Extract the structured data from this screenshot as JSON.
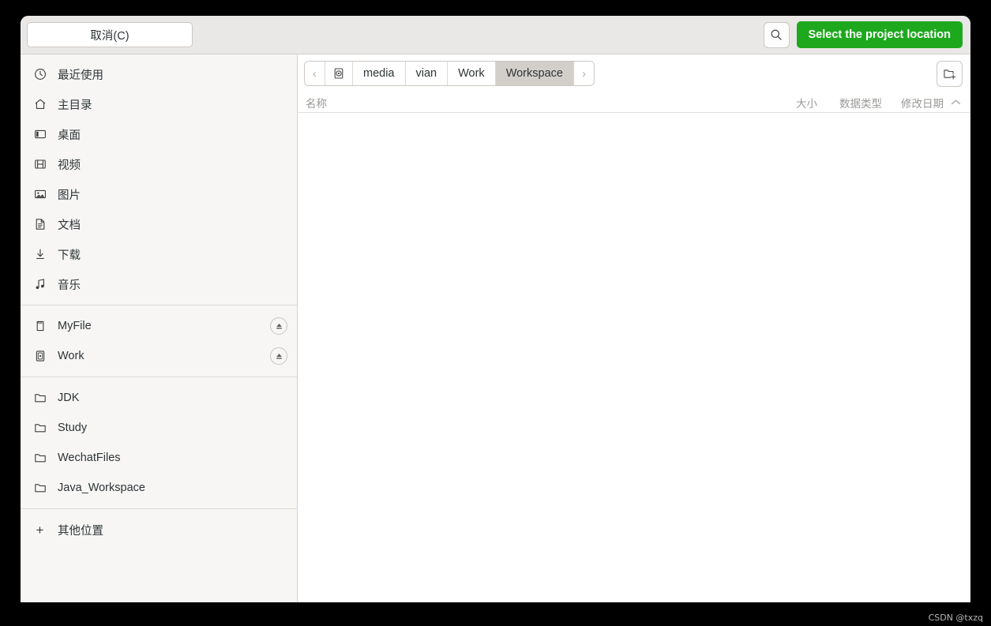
{
  "header": {
    "cancel_label": "取消(C)",
    "search_icon": "search-icon",
    "select_label": "Select the project location",
    "accent_color": "#1da81d"
  },
  "sidebar": {
    "places": [
      {
        "label": "最近使用",
        "icon": "clock-icon"
      },
      {
        "label": "主目录",
        "icon": "home-icon"
      },
      {
        "label": "桌面",
        "icon": "desktop-icon"
      },
      {
        "label": "视频",
        "icon": "film-icon"
      },
      {
        "label": "图片",
        "icon": "image-icon"
      },
      {
        "label": "文档",
        "icon": "document-icon"
      },
      {
        "label": "下载",
        "icon": "download-icon"
      },
      {
        "label": "音乐",
        "icon": "music-icon"
      }
    ],
    "devices": [
      {
        "label": "MyFile",
        "icon": "sd-card-icon",
        "eject": "eject-icon"
      },
      {
        "label": "Work",
        "icon": "drive-icon",
        "eject": "eject-icon"
      }
    ],
    "bookmarks": [
      {
        "label": "JDK",
        "icon": "folder-icon"
      },
      {
        "label": "Study",
        "icon": "folder-icon"
      },
      {
        "label": "WechatFiles",
        "icon": "folder-icon"
      },
      {
        "label": "Java_Workspace",
        "icon": "folder-icon"
      }
    ],
    "other": {
      "label": "其他位置",
      "icon": "plus-icon"
    }
  },
  "pathbar": {
    "prev_label": "‹",
    "next_label": "›",
    "disk_icon": "hard-disk-icon",
    "crumbs": [
      {
        "label": "media",
        "active": false
      },
      {
        "label": "vian",
        "active": false
      },
      {
        "label": "Work",
        "active": false
      },
      {
        "label": "Workspace",
        "active": true
      }
    ],
    "new_folder_icon": "new-folder-icon"
  },
  "columns": {
    "name": "名称",
    "size": "大小",
    "type": "数据类型",
    "date": "修改日期",
    "sort_icon": "chevron-up-icon"
  },
  "file_list": {
    "rows": []
  },
  "watermark": "CSDN @txzq"
}
